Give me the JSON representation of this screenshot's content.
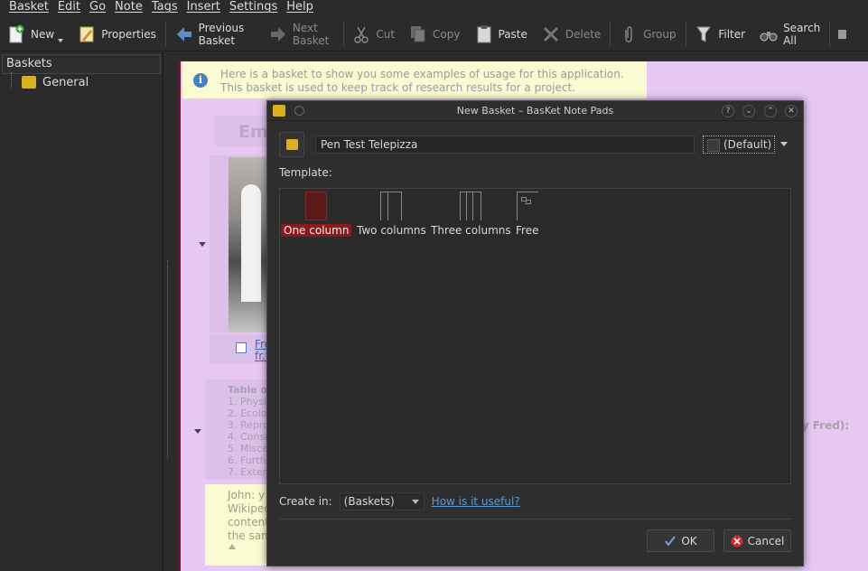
{
  "menubar": [
    "Basket",
    "Edit",
    "Go",
    "Note",
    "Tags",
    "Insert",
    "Settings",
    "Help"
  ],
  "toolbar": {
    "new": "New",
    "properties": "Properties",
    "previous_basket": "Previous Basket",
    "next_basket": "Next Basket",
    "cut": "Cut",
    "copy": "Copy",
    "paste": "Paste",
    "delete": "Delete",
    "group": "Group",
    "filter": "Filter",
    "search_all": "Search All"
  },
  "sidebar": {
    "header": "Baskets",
    "items": [
      {
        "label": "General"
      }
    ]
  },
  "basket": {
    "info_line1": "Here is a basket to show you some examples of usage for this application.",
    "info_line2": "This basket is used to keep track of research results for a project.",
    "heading_fragment": "Em",
    "link_fragment1": "Fro",
    "link_fragment2": "fr.w",
    "toc_fragment": [
      "Table o",
      "1. Physic",
      "2. Ecolo",
      "3. Repro",
      "4. Conse",
      "5. Misce",
      "6. Furthe",
      "7. Exten"
    ],
    "author_fragment": "ay Fred):",
    "yellow_fragment": [
      "John: y",
      "Wikiped",
      "content",
      "the sam"
    ]
  },
  "dialog": {
    "title": "New Basket – BasKet Note Pads",
    "name_value": "Pen Test Telepizza",
    "color_label": "(Default)",
    "template_label": "Template:",
    "templates": [
      {
        "label": "One column",
        "selected": true
      },
      {
        "label": "Two columns",
        "selected": false
      },
      {
        "label": "Three columns",
        "selected": false
      },
      {
        "label": "Free",
        "selected": false
      }
    ],
    "create_in_label": "Create in:",
    "create_in_value": "(Baskets)",
    "help_link": "How is it useful?",
    "ok_label": "OK",
    "cancel_label": "Cancel"
  },
  "colors": {
    "accent_selection": "#8b1a1a",
    "basket_background": "#e6c8f3",
    "link": "#5d9ad6"
  }
}
